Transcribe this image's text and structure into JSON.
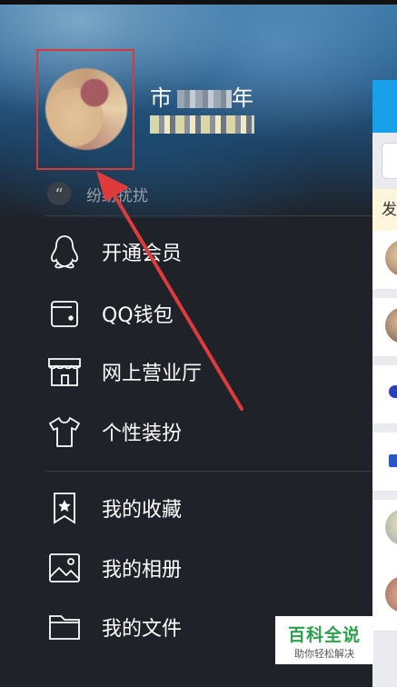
{
  "profile": {
    "nickname_visible": "年",
    "nickname_prefix": "市",
    "signature": "纷纷扰扰"
  },
  "menu": [
    {
      "label": "开通会员",
      "icon": "qq-penguin-icon"
    },
    {
      "label": "QQ钱包",
      "icon": "wallet-icon"
    },
    {
      "label": "网上营业厅",
      "icon": "store-icon"
    },
    {
      "label": "个性装扮",
      "icon": "tshirt-icon"
    },
    {
      "label": "我的收藏",
      "icon": "bookmark-star-icon"
    },
    {
      "label": "我的相册",
      "icon": "image-icon"
    },
    {
      "label": "我的文件",
      "icon": "folder-icon"
    }
  ],
  "right_panel": {
    "notice_text": "发"
  },
  "watermark": {
    "title": "百科全说",
    "subtitle": "助你轻松解决"
  },
  "colors": {
    "highlight_box": "#d63a3a",
    "arrow": "#e03a3a",
    "accent": "#1aa0e8"
  }
}
